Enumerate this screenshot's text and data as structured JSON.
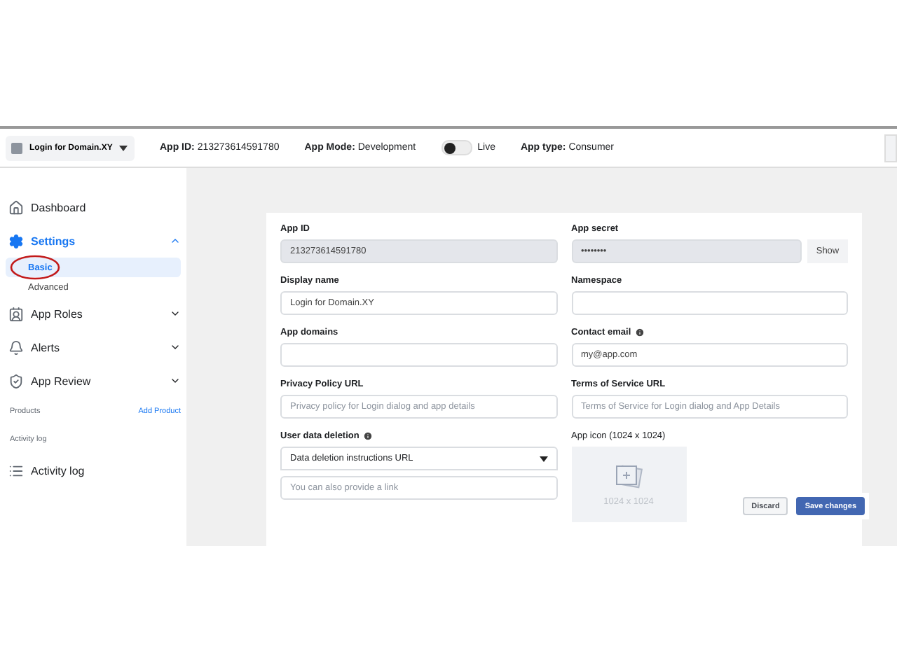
{
  "topbar": {
    "app_switcher": "Login for Domain.XY",
    "app_id_label": "App ID:",
    "app_id": "213273614591780",
    "mode_label": "App Mode:",
    "mode": "Development",
    "live": false,
    "live_label": "Live",
    "type_label": "App type:",
    "type": "Consumer"
  },
  "sidebar": {
    "items": [
      {
        "kind": "link",
        "label": "Dashboard"
      },
      {
        "kind": "group",
        "label": "Settings",
        "expanded": true,
        "children": [
          {
            "label": "Basic",
            "selected": true
          },
          {
            "label": "Advanced",
            "selected": false
          }
        ]
      },
      {
        "kind": "group",
        "label": "App Roles",
        "expanded": false
      },
      {
        "kind": "group",
        "label": "Alerts",
        "expanded": false
      },
      {
        "kind": "group",
        "label": "App Review",
        "expanded": false
      },
      {
        "kind": "section",
        "label": "Products",
        "action": "Add Product"
      },
      {
        "kind": "section",
        "label": "Activity log"
      },
      {
        "kind": "link",
        "label": "Activity log"
      }
    ]
  },
  "form": {
    "left": [
      {
        "kind": "readonly",
        "label": "App ID",
        "value": "213273614591780"
      },
      {
        "kind": "input",
        "label": "Display name",
        "value": "Login for Domain.XY"
      },
      {
        "kind": "input",
        "label": "App domains"
      },
      {
        "kind": "input",
        "label": "Privacy Policy URL",
        "placeholder": "Privacy policy for Login dialog and app details"
      },
      {
        "kind": "select",
        "label": "User data deletion",
        "info": true,
        "value": "Data deletion instructions URL",
        "placeholder": "You can also provide a link"
      }
    ],
    "right": [
      {
        "kind": "secret",
        "label": "App secret",
        "value": "••••••••",
        "button": "Show"
      },
      {
        "kind": "input",
        "label": "Namespace"
      },
      {
        "kind": "input",
        "label": "Contact email",
        "info": true,
        "value": "my@app.com"
      },
      {
        "kind": "input",
        "label": "Terms of Service URL",
        "placeholder": "Terms of Service for Login dialog and App Details"
      },
      {
        "kind": "image",
        "label": "App icon (1024 x 1024)",
        "caption": "1024 x 1024"
      }
    ]
  },
  "actions": [
    "Discard",
    "Save changes"
  ]
}
